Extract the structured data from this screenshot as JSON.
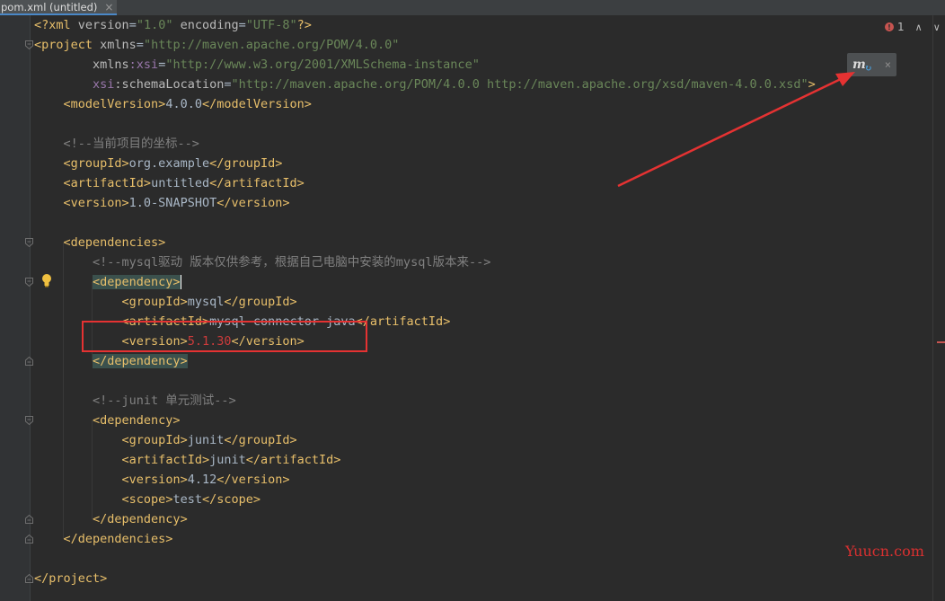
{
  "tab": {
    "title": "pom.xml (untitled)",
    "close": "×"
  },
  "status": {
    "error_count": "1",
    "error_icon": "!",
    "up": "∧",
    "down": "∨"
  },
  "maven_popup": {
    "icon_letter": "m",
    "refresh_glyph": "↻",
    "close": "×"
  },
  "watermark": "Yuucn.com",
  "code": {
    "l1": {
      "a": "<?xml ",
      "b": "version",
      "c": "=",
      "d": "\"1.0\"",
      "e": " encoding",
      "f": "=",
      "g": "\"UTF-8\"",
      "h": "?>"
    },
    "l2": {
      "a": "<project ",
      "b": "xmlns",
      "c": "=",
      "d": "\"http://maven.apache.org/POM/4.0.0\""
    },
    "l3": {
      "a": "xmlns",
      "b": ":xsi",
      "c": "=",
      "d": "\"http://www.w3.org/2001/XMLSchema-instance\""
    },
    "l4": {
      "a": "xsi",
      "b": ":schemaLocation",
      "c": "=",
      "d": "\"http://maven.apache.org/POM/4.0.0 http://maven.apache.org/xsd/maven-4.0.0.xsd\"",
      "e": ">"
    },
    "l5": {
      "a": "<modelVersion>",
      "b": "4.0.0",
      "c": "</modelVersion>"
    },
    "l7": {
      "a": "<!--当前项目的坐标-->"
    },
    "l8": {
      "a": "<groupId>",
      "b": "org.example",
      "c": "</groupId>"
    },
    "l9": {
      "a": "<artifactId>",
      "b": "untitled",
      "c": "</artifactId>"
    },
    "l10": {
      "a": "<version>",
      "b": "1.0-SNAPSHOT",
      "c": "</version>"
    },
    "l12": {
      "a": "<dependencies>"
    },
    "l13": {
      "a": "<!--mysql驱动 版本仅供参考，根据自己电脑中安装的mysql版本来-->"
    },
    "l14": {
      "a": "<dependency>"
    },
    "l15": {
      "a": "<groupId>",
      "b": "mysql",
      "c": "</groupId>"
    },
    "l16": {
      "a": "<artifactId>",
      "b": "mysql-connector-java",
      "c": "</artifactId>"
    },
    "l17": {
      "a": "<version>",
      "b": "5.1.30",
      "c": "</version>"
    },
    "l18": {
      "a": "</dependency>"
    },
    "l20": {
      "a": "<!--junit 单元测试-->"
    },
    "l21": {
      "a": "<dependency>"
    },
    "l22": {
      "a": "<groupId>",
      "b": "junit",
      "c": "</groupId>"
    },
    "l23": {
      "a": "<artifactId>",
      "b": "junit",
      "c": "</artifactId>"
    },
    "l24": {
      "a": "<version>",
      "b": "4.12",
      "c": "</version>"
    },
    "l25": {
      "a": "<scope>",
      "b": "test",
      "c": "</scope>"
    },
    "l26": {
      "a": "</dependency>"
    },
    "l27": {
      "a": "</dependencies>"
    },
    "l29": {
      "a": "</project>"
    }
  }
}
